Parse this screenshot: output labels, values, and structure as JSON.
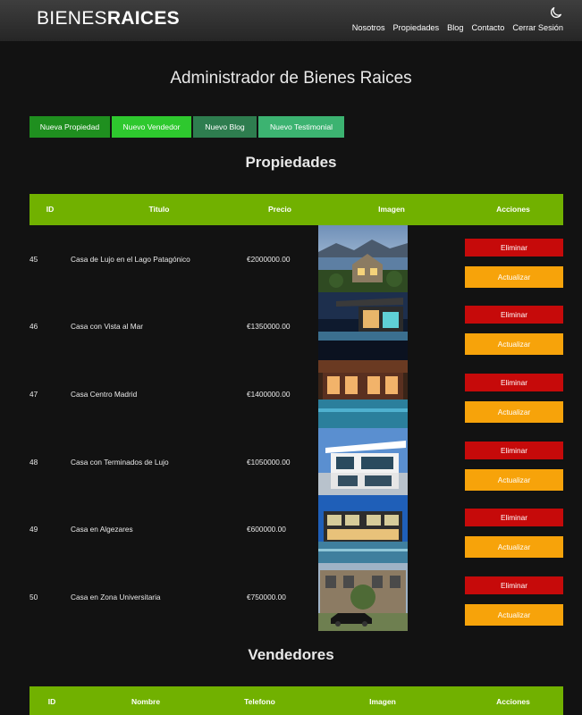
{
  "header": {
    "logo_thin": "BIENES",
    "logo_bold": "RAICES",
    "nav": [
      "Nosotros",
      "Propiedades",
      "Blog",
      "Contacto",
      "Cerrar Sesión"
    ],
    "moon_icon": "moon-icon"
  },
  "main": {
    "title": "Administrador de Bienes Raices",
    "buttons": [
      {
        "label": "Nueva Propiedad",
        "color": "#1f8f1f"
      },
      {
        "label": "Nuevo Vendedor",
        "color": "#2ec82e"
      },
      {
        "label": "Nuevo Blog",
        "color": "#2e7d4f"
      },
      {
        "label": "Nuevo Testimonial",
        "color": "#3cb371"
      }
    ]
  },
  "propiedades": {
    "title": "Propiedades",
    "headers": [
      "ID",
      "Titulo",
      "Precio",
      "Imagen",
      "Acciones"
    ],
    "rows": [
      {
        "id": "45",
        "titulo": "Casa de Lujo en el Lago Patagónico",
        "precio": "€2000000.00"
      },
      {
        "id": "46",
        "titulo": "Casa con Vista al Mar",
        "precio": "€1350000.00"
      },
      {
        "id": "47",
        "titulo": "Casa Centro Madrid",
        "precio": "€1400000.00"
      },
      {
        "id": "48",
        "titulo": "Casa con Terminados de Lujo",
        "precio": "€1050000.00"
      },
      {
        "id": "49",
        "titulo": "Casa en Algezares",
        "precio": "€600000.00"
      },
      {
        "id": "50",
        "titulo": "Casa en Zona Universitaria",
        "precio": "€750000.00"
      }
    ],
    "delete_label": "Eliminar",
    "update_label": "Actualizar"
  },
  "vendedores": {
    "title": "Vendedores",
    "headers": [
      "ID",
      "Nombre",
      "Telefono",
      "Imagen",
      "Acciones"
    ]
  },
  "colors": {
    "table_header": "#71b100",
    "delete": "#c60a0a",
    "update": "#f7a30a",
    "background": "#121212"
  }
}
